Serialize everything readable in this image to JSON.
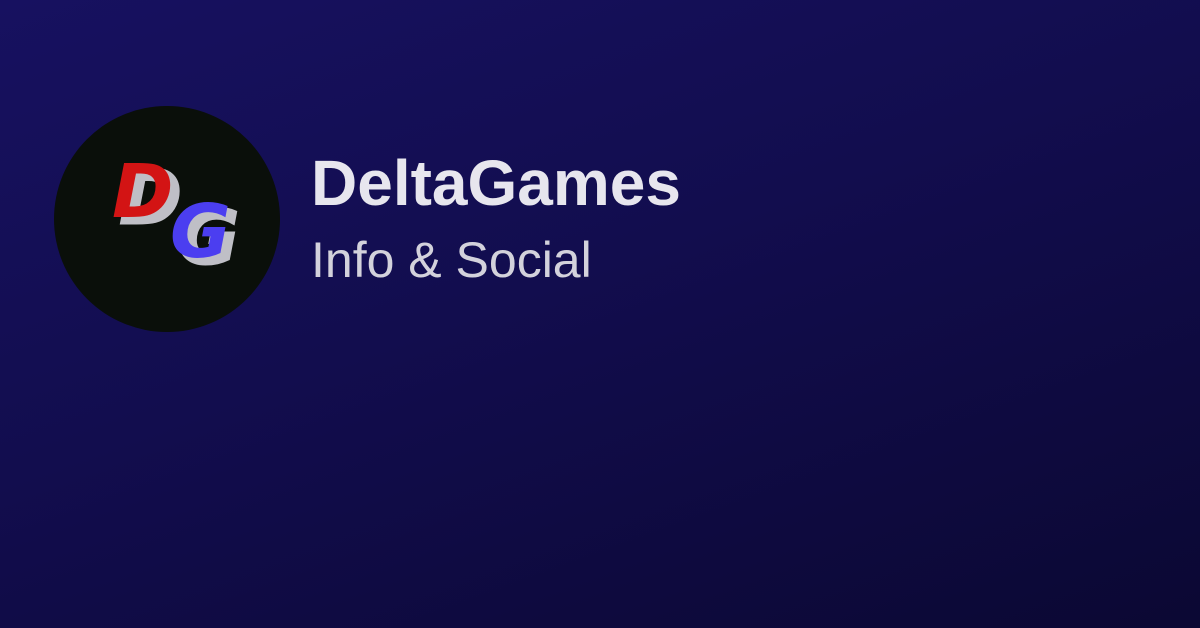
{
  "profile": {
    "name": "DeltaGames",
    "tagline": "Info & Social",
    "logo": {
      "letters": [
        "D",
        "G"
      ],
      "colors": {
        "d_fill": "#d31414",
        "g_fill": "#4b3ef0",
        "outline": "#bfbfc6",
        "circle": "#0a0f0a"
      }
    }
  },
  "colors": {
    "background_top": "#171160",
    "background_bottom": "#0b0833",
    "title_text": "#e7e6ee",
    "subtitle_text": "#d3d2dc"
  }
}
